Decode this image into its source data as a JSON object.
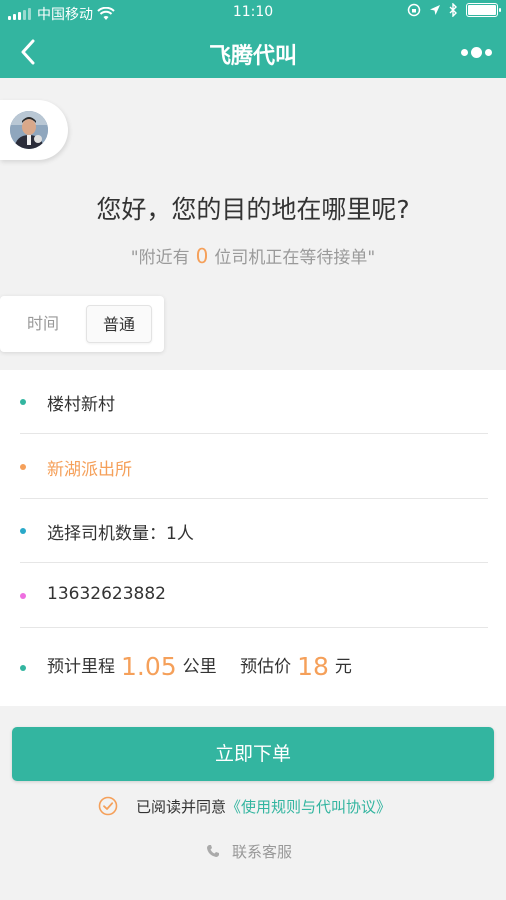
{
  "status_bar": {
    "carrier": "中国移动",
    "time": "11:10",
    "icons": [
      "signal-icon",
      "wifi-icon",
      "orientation-lock-icon",
      "location-icon",
      "bluetooth-icon",
      "battery-icon"
    ]
  },
  "nav": {
    "title": "飞腾代叫",
    "back_icon": "chevron-left-icon",
    "more_icon": "more-dots-icon"
  },
  "greeting": "您好，您的目的地在哪里呢?",
  "nearby": {
    "prefix": "\"附近有",
    "count": "0",
    "suffix": "位司机正在等待接单\""
  },
  "tabs": [
    {
      "label": "时间",
      "selected": false
    },
    {
      "label": "普通",
      "selected": true
    }
  ],
  "order": {
    "origin": "楼村新村",
    "destination": "新湖派出所",
    "driver_count": "选择司机数量：1人",
    "phone": "13632623882",
    "distance_label": "预计里程",
    "distance_value": "1.05",
    "distance_unit": "公里",
    "price_label": "预估价",
    "price_value": "18",
    "price_unit": "元"
  },
  "submit_label": "立即下单",
  "agreement": {
    "text": "已阅读并同意",
    "link": "《使用规则与代叫协议》"
  },
  "service_label": "联系客服",
  "colors": {
    "primary": "#33b5a0",
    "accent_orange": "#f5a05a",
    "dot_teal": "#33b5a0",
    "dot_orange": "#f5a05a",
    "dot_cyan": "#2aa9c9",
    "dot_pink": "#ee6fe0",
    "background": "#f2f2f2"
  }
}
